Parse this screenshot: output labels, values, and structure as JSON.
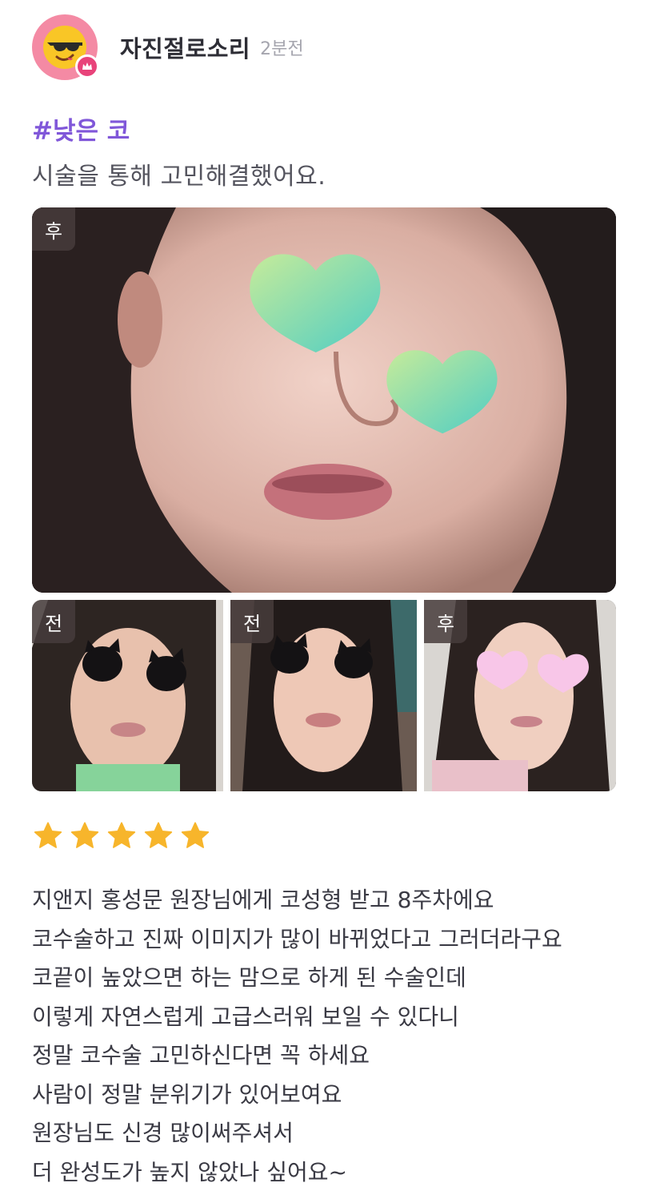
{
  "post": {
    "username": "자진절로소리",
    "time": "2분전",
    "hashtag": "#낮은 코",
    "subtitle": "시술을 통해 고민해결했어요.",
    "rating": 5
  },
  "photos": {
    "main_tag": "후",
    "thumbs": [
      {
        "tag": "전"
      },
      {
        "tag": "전"
      },
      {
        "tag": "후"
      }
    ]
  },
  "review": {
    "lines": [
      "지앤지 홍성문 원장님에게 코성형 받고 8주차에요",
      "코수술하고 진짜 이미지가 많이 바뀌었다고 그러더라구요",
      "코끝이 높았으면 하는 맘으로 하게 된 수술인데",
      "이렇게 자연스럽게 고급스러워 보일 수 있다니",
      "정말 코수술 고민하신다면 꼭 하세요",
      "사람이 정말 분위기가 있어보여요",
      "원장님도 신경 많이써주셔서",
      "더 완성도가 높지 않았나 싶어요~"
    ]
  },
  "colors": {
    "hashtag": "#8057d9",
    "avatar_bg": "#f48aa4",
    "star": "#f7b52b",
    "heart_mint": "#7fd9b8",
    "heart_pink": "#f6b8de"
  }
}
